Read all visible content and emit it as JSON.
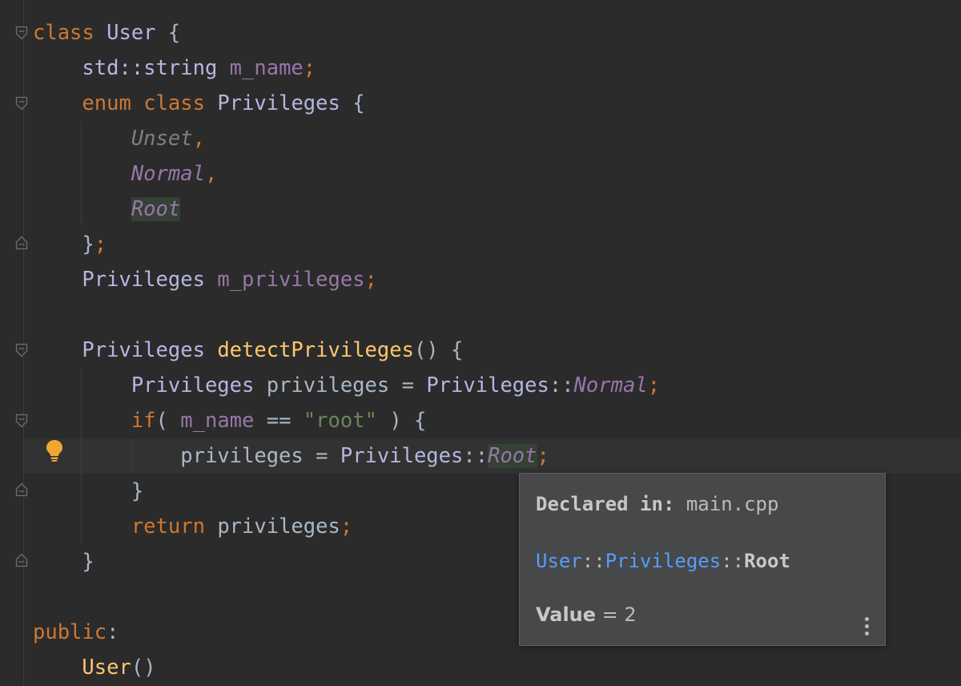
{
  "editor": {
    "lines": {
      "l1": {
        "kw": "class",
        "name": "User",
        "brace": "{"
      },
      "l2": {
        "type": "std::string",
        "field": "m_name",
        "semi": ";"
      },
      "l3": {
        "kw1": "enum",
        "kw2": "class",
        "name": "Privileges",
        "brace": "{"
      },
      "l4": {
        "const": "Unset",
        "comma": ","
      },
      "l5": {
        "const": "Normal",
        "comma": ","
      },
      "l6": {
        "const": "Root"
      },
      "l7": {
        "close": "}",
        "semi": ";"
      },
      "l8": {
        "type": "Privileges",
        "field": "m_privileges",
        "semi": ";"
      },
      "l10": {
        "type": "Privileges",
        "fn": "detectPrivileges",
        "rest": "() {"
      },
      "l11": {
        "type": "Privileges",
        "var": "privileges",
        "eq": "=",
        "scope": "Privileges",
        "sep": "::",
        "const": "Normal",
        "semi": ";"
      },
      "l12": {
        "kw": "if",
        "paren": "(",
        "field": "m_name",
        "op": "==",
        "str": "\"root\"",
        "close": ") {"
      },
      "l13": {
        "var": "privileges",
        "eq": "=",
        "scope": "Privileges",
        "sep": "::",
        "const": "Root",
        "semi": ";"
      },
      "l14": {
        "close": "}"
      },
      "l15": {
        "kw": "return",
        "var": "privileges",
        "semi": ";"
      },
      "l16": {
        "close": "}"
      },
      "l18": {
        "kw": "public",
        "colon": ":"
      },
      "l19": {
        "name": "User",
        "rest": "()"
      }
    }
  },
  "popup": {
    "declared_label": "Declared in:",
    "declared_file": "main.cpp",
    "path_part1": "User",
    "path_sep1": "::",
    "path_part2": "Privileges",
    "path_sep2": "::",
    "path_name": "Root",
    "value_label": "Value",
    "value_eq": " = 2"
  },
  "colors": {
    "background": "#2b2b2b",
    "keyword": "#cc7832",
    "class_name": "#b5b6e3",
    "field": "#9876aa",
    "function": "#ffc66d",
    "string": "#6a8759",
    "popup_bg": "#46484a",
    "link": "#589df6",
    "bulb": "#f0a732"
  },
  "icons": [
    "fold-start-icon",
    "fold-end-icon",
    "intention-bulb-icon",
    "more-options-icon"
  ]
}
